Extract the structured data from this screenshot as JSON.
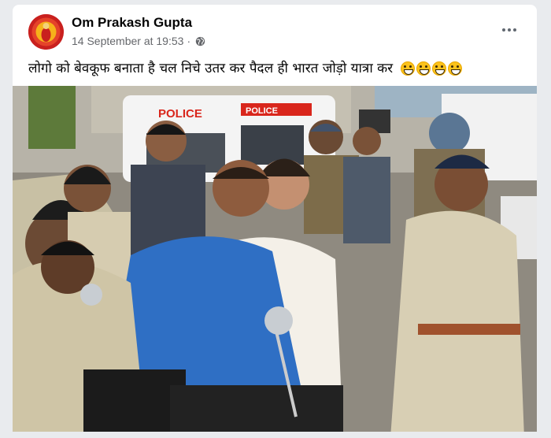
{
  "post": {
    "author": "Om Prakash Gupta",
    "date": "14 September at 19:53",
    "separator": "·",
    "privacy_icon": "globe-icon",
    "more_icon": "more-horizontal-icon",
    "text": "लोगो को बेवकूफ बनाता है चल निचे उतर कर पैदल ही भारत जोड़ो यात्रा कर",
    "emoji": [
      "😁",
      "😁",
      "😁",
      "😁"
    ],
    "photo": {
      "van_label": "POLICE",
      "van_label_2": "POLICE"
    }
  },
  "colors": {
    "avatar_bg": "#c9201e",
    "meta_text": "#65676b",
    "kurta_blue": "#2f6fc4",
    "police_khaki": "#d8cfb4"
  }
}
